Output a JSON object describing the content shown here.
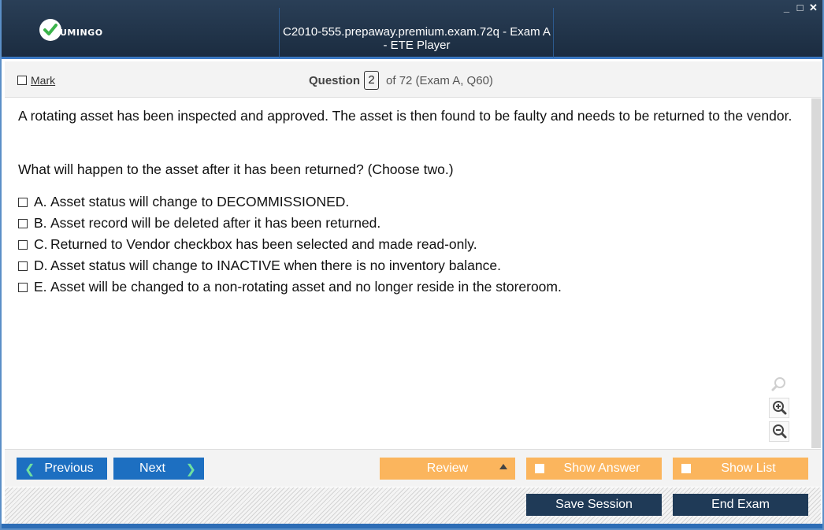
{
  "app": {
    "logo_text": "UMINGO",
    "window_title": "C2010-555.prepaway.premium.exam.72q - Exam A - ETE Player",
    "controls": [
      "_",
      "□",
      "✕"
    ]
  },
  "header": {
    "mark_label": "Mark",
    "question_label": "Question",
    "question_number": "2",
    "question_suffix": "of 72 (Exam A, Q60)"
  },
  "question": {
    "stem": "A rotating asset has been inspected and approved. The asset is then found to be faulty and needs to be returned to the vendor.",
    "prompt": "What will happen to the asset after it has been returned? (Choose two.)",
    "choices": [
      {
        "letter": "A.",
        "text": "Asset status will change to DECOMMISSIONED."
      },
      {
        "letter": "B.",
        "text": "Asset record will be deleted after it has been returned."
      },
      {
        "letter": "C.",
        "text": "Returned to Vendor checkbox has been selected and made read-only."
      },
      {
        "letter": "D.",
        "text": "Asset status will change to INACTIVE when there is no inventory balance."
      },
      {
        "letter": "E.",
        "text": "Asset will be changed to a non-rotating asset and no longer reside in the storeroom."
      }
    ]
  },
  "zoom": {
    "icons": [
      "zoom-reset-icon",
      "zoom-in-icon",
      "zoom-out-icon"
    ]
  },
  "nav": {
    "previous": "Previous",
    "next": "Next",
    "review": "Review",
    "show_answer": "Show Answer",
    "show_list": "Show List",
    "save_session": "Save Session",
    "end_exam": "End Exam"
  },
  "colors": {
    "titlebar": "#1b2c40",
    "accent_blue": "#1d6fc1",
    "orange": "#fbb55d",
    "dark_button": "#1f3a57",
    "arrow_green": "#6fe0a0"
  }
}
